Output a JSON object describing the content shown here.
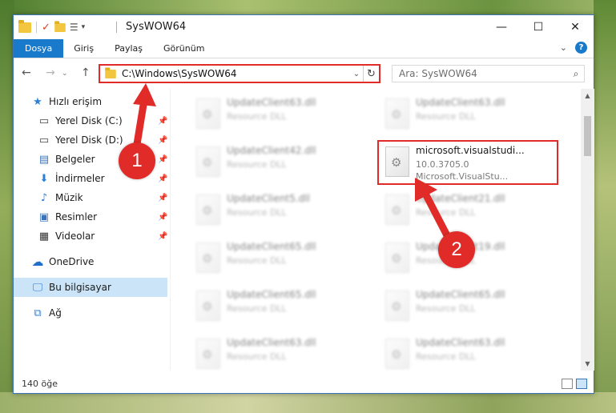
{
  "window": {
    "title": "SysWOW64",
    "minimize": "—",
    "maximize": "☐",
    "close": "✕"
  },
  "ribbon": {
    "tabs": [
      "Dosya",
      "Giriş",
      "Paylaş",
      "Görünüm"
    ],
    "expand": "⌄",
    "help": "?"
  },
  "navigation": {
    "back": "←",
    "forward": "→",
    "up": "↑",
    "address": "C:\\Windows\\SysWOW64",
    "address_dropdown": "⌄",
    "refresh": "↻",
    "search_placeholder": "Ara: SysWOW64",
    "search_icon": "⌕"
  },
  "sidebar": {
    "items": [
      {
        "label": "Hızlı erişim",
        "icon": "star-icon",
        "glyph": "★",
        "color": "#2b7fd8"
      },
      {
        "label": "Yerel Disk (C:)",
        "icon": "drive-icon",
        "glyph": "▭",
        "color": "#444444",
        "pinned": true
      },
      {
        "label": "Yerel Disk (D:)",
        "icon": "drive-icon",
        "glyph": "▭",
        "color": "#444444",
        "pinned": true
      },
      {
        "label": "Belgeler",
        "icon": "documents-icon",
        "glyph": "▤",
        "color": "#3b73b9",
        "pinned": true
      },
      {
        "label": "İndirmeler",
        "icon": "download-icon",
        "glyph": "⬇",
        "color": "#2b7fd8",
        "pinned": true
      },
      {
        "label": "Müzik",
        "icon": "music-icon",
        "glyph": "♪",
        "color": "#2b7fd8",
        "pinned": true
      },
      {
        "label": "Resimler",
        "icon": "pictures-icon",
        "glyph": "▣",
        "color": "#3b73b9",
        "pinned": true
      },
      {
        "label": "Videolar",
        "icon": "videos-icon",
        "glyph": "▦",
        "color": "#333333",
        "pinned": true
      },
      {
        "label": "OneDrive",
        "icon": "cloud-icon",
        "glyph": "☁",
        "color": "#1e6fc7"
      },
      {
        "label": "Bu bilgisayar",
        "icon": "computer-icon",
        "glyph": "🖵",
        "color": "#2b7fd8",
        "selected": true
      },
      {
        "label": "Ağ",
        "icon": "network-icon",
        "glyph": "⧉",
        "color": "#2b7fd8"
      }
    ],
    "pin_glyph": "📌"
  },
  "files": [
    {
      "name": "UpdateClient63.dll",
      "type": "Resource DLL",
      "blurred": true
    },
    {
      "name": "UpdateClient63.dll",
      "type": "Resource DLL",
      "blurred": true
    },
    {
      "name": "UpdateClient42.dll",
      "type": "Resource DLL",
      "blurred": true
    },
    {
      "name": "microsoft.visualstudi...",
      "version": "10.0.3705.0",
      "type": "Microsoft.VisualStu...",
      "highlighted": true
    },
    {
      "name": "UpdateClient5.dll",
      "type": "Resource DLL",
      "blurred": true
    },
    {
      "name": "UpdateClient21.dll",
      "type": "Resource DLL",
      "blurred": true
    },
    {
      "name": "UpdateClient65.dll",
      "type": "Resource DLL",
      "blurred": true
    },
    {
      "name": "UpdateClient19.dll",
      "type": "Resource DLL",
      "blurred": true
    },
    {
      "name": "UpdateClient65.dll",
      "type": "Resource DLL",
      "blurred": true
    },
    {
      "name": "UpdateClient65.dll",
      "type": "Resource DLL",
      "blurred": true
    },
    {
      "name": "UpdateClient63.dll",
      "type": "Resource DLL",
      "blurred": true
    },
    {
      "name": "UpdateClient63.dll",
      "type": "Resource DLL",
      "blurred": true
    }
  ],
  "status": {
    "item_count": "140 öğe"
  },
  "annotations": {
    "step1": "1",
    "step2": "2",
    "color": "#e02b28"
  }
}
